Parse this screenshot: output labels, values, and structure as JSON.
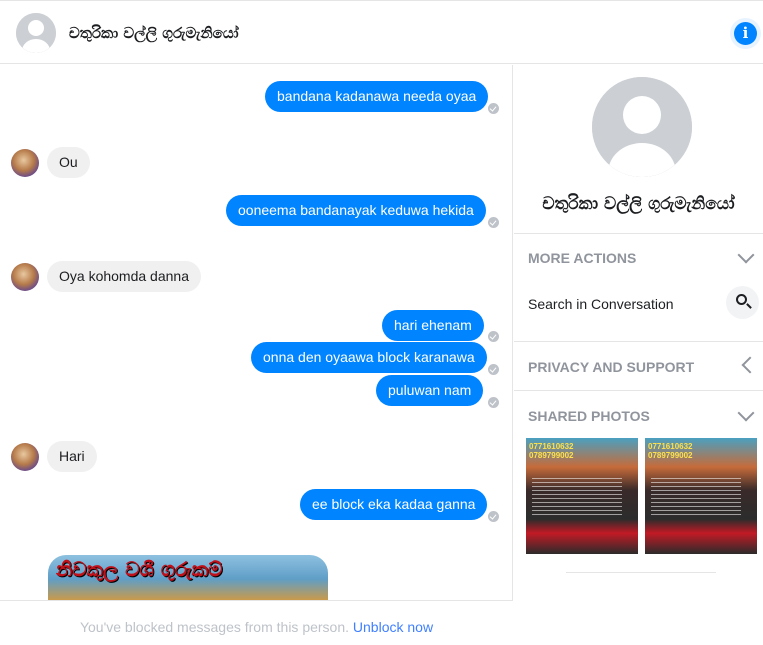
{
  "header": {
    "title": "චතුරිකා වල්ලි ගුරුමැනියෝ",
    "avatar_icon": "default-avatar-icon",
    "info_icon": "info-icon",
    "info_glyph": "i"
  },
  "messages": [
    {
      "dir": "out",
      "text": "bandana kadanawa needa oyaa"
    },
    {
      "dir": "in",
      "text": "Ou"
    },
    {
      "dir": "out",
      "text": "ooneema bandanayak keduwa hekida"
    },
    {
      "dir": "in",
      "text": "Oya kohomda danna"
    },
    {
      "dir": "out",
      "text": "hari ehenam"
    },
    {
      "dir": "out",
      "text": "onna den oyaawa block karanawa"
    },
    {
      "dir": "out",
      "text": "puluwan nam"
    },
    {
      "dir": "in",
      "text": "Hari"
    },
    {
      "dir": "out",
      "text": "ee block eka kadaa ganna"
    }
  ],
  "image_message": {
    "banner_text": "නිවකුල වශී ගුරුකම්"
  },
  "footer": {
    "notice": "You've blocked messages from this person.",
    "link": "Unblock now"
  },
  "sidebar": {
    "name": "චතුරිකා වල්ලි ගුරුමැනියෝ",
    "more_actions": "MORE ACTIONS",
    "search_label": "Search in Conversation",
    "privacy": "PRIVACY AND SUPPORT",
    "shared_photos": "SHARED PHOTOS",
    "photo_overlay": [
      "0771610632",
      "0789799002"
    ]
  },
  "colors": {
    "accent": "#0084ff",
    "incoming": "#f1f0f0",
    "muted": "#90949c",
    "link": "#4080ff"
  }
}
